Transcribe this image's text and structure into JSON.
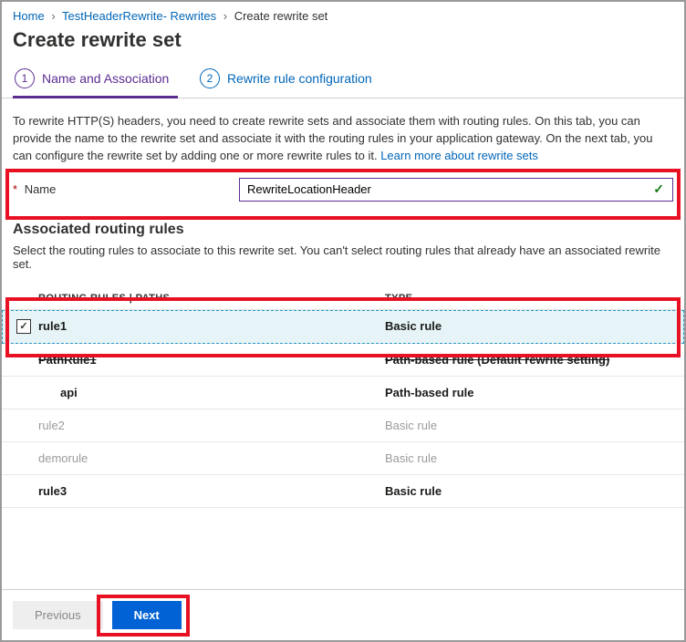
{
  "breadcrumb": {
    "home": "Home",
    "resource": "TestHeaderRewrite- Rewrites",
    "current": "Create rewrite set"
  },
  "page_title": "Create rewrite set",
  "tabs": {
    "step1_num": "1",
    "step1_label": "Name and Association",
    "step2_num": "2",
    "step2_label": "Rewrite rule configuration"
  },
  "info": {
    "body": "To rewrite HTTP(S) headers, you need to create rewrite sets and associate them with routing rules. On this tab, you can provide the name to the rewrite set and associate it with the routing rules in your application gateway. On the next tab, you can configure the rewrite set by adding one or more rewrite rules to it.  ",
    "link": "Learn more about rewrite sets"
  },
  "form": {
    "name_label": "Name",
    "name_value": "RewriteLocationHeader"
  },
  "section2": {
    "title": "Associated routing rules",
    "sub": "Select the routing rules to associate to this rewrite set. You can't select routing rules that already have an associated rewrite set."
  },
  "table": {
    "col1": "ROUTING RULES | PATHS",
    "col2": "TYPE",
    "rows": [
      {
        "checked": true,
        "indent": 0,
        "name": "rule1",
        "type": "Basic rule",
        "style": "bold selected"
      },
      {
        "checked": null,
        "indent": 0,
        "name": "PathRule1",
        "type": "Path-based rule (Default rewrite setting)",
        "style": "bold strike"
      },
      {
        "checked": null,
        "indent": 1,
        "name": "api",
        "type": "Path-based rule",
        "style": "bold"
      },
      {
        "checked": null,
        "indent": 0,
        "name": "rule2",
        "type": "Basic rule",
        "style": "dim"
      },
      {
        "checked": null,
        "indent": 0,
        "name": "demorule",
        "type": "Basic rule",
        "style": "dim"
      },
      {
        "checked": null,
        "indent": 0,
        "name": "rule3",
        "type": "Basic rule",
        "style": "bold"
      }
    ]
  },
  "footer": {
    "previous": "Previous",
    "next": "Next"
  }
}
